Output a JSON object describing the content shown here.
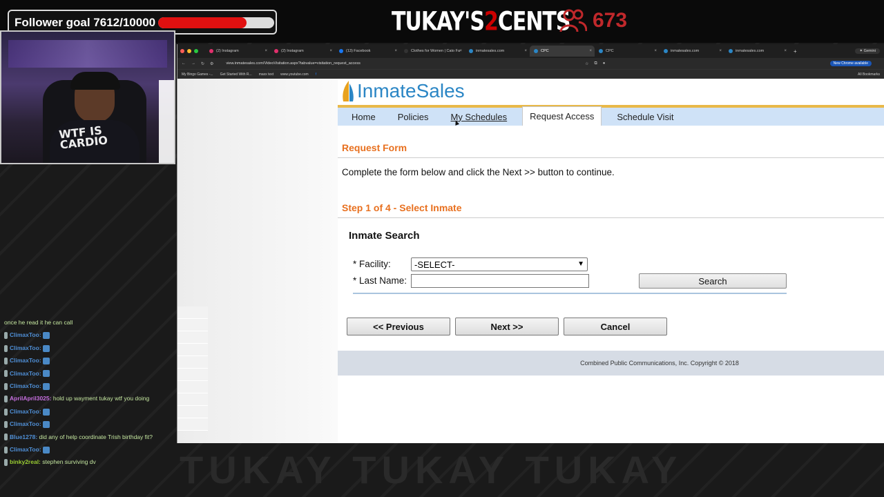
{
  "overlay": {
    "follower_goal_label": "Follower goal 7612/10000",
    "follower_goal_progress": 0.7612,
    "brand_left": "TUKAY'S",
    "brand_mid": "2",
    "brand_right": "CENTS",
    "viewer_count": "673",
    "viewer_icon": "users-icon",
    "bottom_watermark": "TUKAY TUKAY TUKAY"
  },
  "webcam": {
    "shirt_text_1": "WTF IS",
    "shirt_text_2": "CARDIO"
  },
  "chat": [
    {
      "user": "",
      "user_color": "#c5e7a0",
      "msg": "once he read it he can call"
    },
    {
      "user": "ClimaxToo:",
      "user_color": "#4f8fd6",
      "msg": ""
    },
    {
      "user": "ClimaxToo:",
      "user_color": "#4f8fd6",
      "msg": ""
    },
    {
      "user": "ClimaxToo:",
      "user_color": "#4f8fd6",
      "msg": ""
    },
    {
      "user": "ClimaxToo:",
      "user_color": "#4f8fd6",
      "msg": ""
    },
    {
      "user": "ClimaxToo:",
      "user_color": "#4f8fd6",
      "msg": ""
    },
    {
      "user": "AprilApril3025:",
      "user_color": "#c76fe0",
      "msg": "hold up wayment tukay wtf you doing"
    },
    {
      "user": "ClimaxToo:",
      "user_color": "#4f8fd6",
      "msg": ""
    },
    {
      "user": "ClimaxToo:",
      "user_color": "#4f8fd6",
      "msg": ""
    },
    {
      "user": "Blue1278:",
      "user_color": "#4f8fd6",
      "msg": "did any of help coordinate Trish birthday fit?"
    },
    {
      "user": "ClimaxToo:",
      "user_color": "#4f8fd6",
      "msg": ""
    },
    {
      "user": "binky2real:",
      "user_color": "#9acd32",
      "msg": "stephen surviving dv"
    }
  ],
  "browser": {
    "tabs": [
      {
        "label": "(2) Instagram",
        "fav": "#e1306c",
        "active": false
      },
      {
        "label": "(2) Instagram",
        "fav": "#e1306c",
        "active": false
      },
      {
        "label": "(13) Facebook",
        "fav": "#1877f2",
        "active": false
      },
      {
        "label": "Clothes for Women | Cato Fa",
        "fav": "#333",
        "active": false
      },
      {
        "label": "inmatesales.com",
        "fav": "#2b86c5",
        "active": false
      },
      {
        "label": "CPC",
        "fav": "#2b86c5",
        "active": true
      },
      {
        "label": "CPC",
        "fav": "#2b86c5",
        "active": false
      },
      {
        "label": "inmatesales.com",
        "fav": "#2b86c5",
        "active": false
      },
      {
        "label": "inmatesales.com",
        "fav": "#2b86c5",
        "active": false
      }
    ],
    "gemini_label": "Gemini",
    "url": "view.inmatesales.com/VideoVisitation.aspx?tabvalue=visitation_request_access",
    "chrome_available": "New Chrome available",
    "bookmarks": [
      "My Bingo Games -...",
      "Get Started With R...",
      "maxx text",
      "www.youtube.com"
    ],
    "all_bookmarks": "All Bookmarks"
  },
  "site": {
    "logo_inmate": "Inmate",
    "logo_sales": "Sales",
    "nav": [
      {
        "label": "Home",
        "active": false
      },
      {
        "label": "Policies",
        "active": false
      },
      {
        "label": "My Schedules",
        "active": false
      },
      {
        "label": "Request Access",
        "active": true
      },
      {
        "label": "Schedule Visit",
        "active": false
      }
    ],
    "form_title": "Request Form",
    "instructions": "Complete the form below and click the Next >> button to continue.",
    "step_title": "Step 1 of 4 - Select Inmate",
    "search_title": "Inmate Search",
    "facility_label": "* Facility:",
    "facility_value": "-SELECT-",
    "lastname_label": "* Last Name:",
    "lastname_value": "",
    "search_button": "Search",
    "prev_button": "<< Previous",
    "next_button": "Next >>",
    "cancel_button": "Cancel",
    "copyright": "Combined Public Communications, Inc. Copyright © 2018"
  }
}
